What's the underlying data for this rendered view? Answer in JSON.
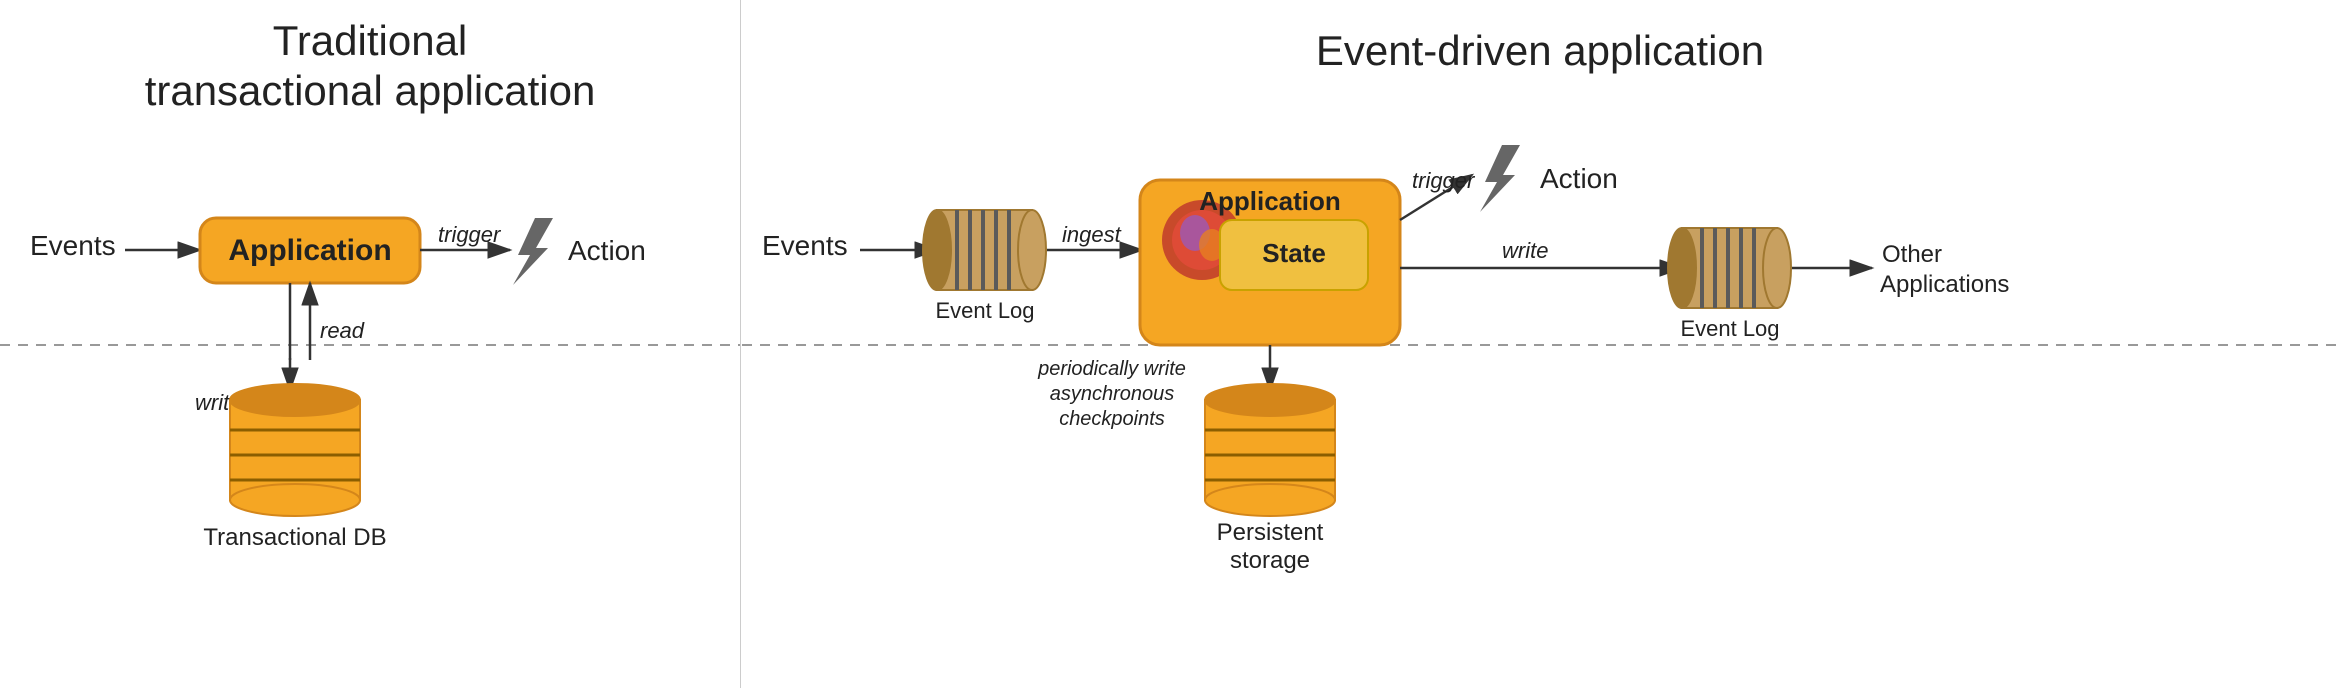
{
  "left": {
    "title": "Traditional\ntransactional application",
    "elements": {
      "events_label": "Events",
      "application_label": "Application",
      "trigger_label": "trigger",
      "action_label": "Action",
      "write_label": "write",
      "read_label": "read",
      "db_label": "Transactional DB"
    }
  },
  "right": {
    "title": "Event-driven application",
    "elements": {
      "events_label": "Events",
      "event_log_label": "Event Log",
      "ingest_label": "ingest",
      "application_label": "Application",
      "state_label": "State",
      "trigger_label": "trigger",
      "action_label": "Action",
      "write_label": "write",
      "event_log2_label": "Event Log",
      "other_apps_label": "Other Applications",
      "checkpoint_label": "periodically write\nasynchronous\ncheckpoints",
      "persistent_label": "Persistent\nstorage"
    }
  }
}
